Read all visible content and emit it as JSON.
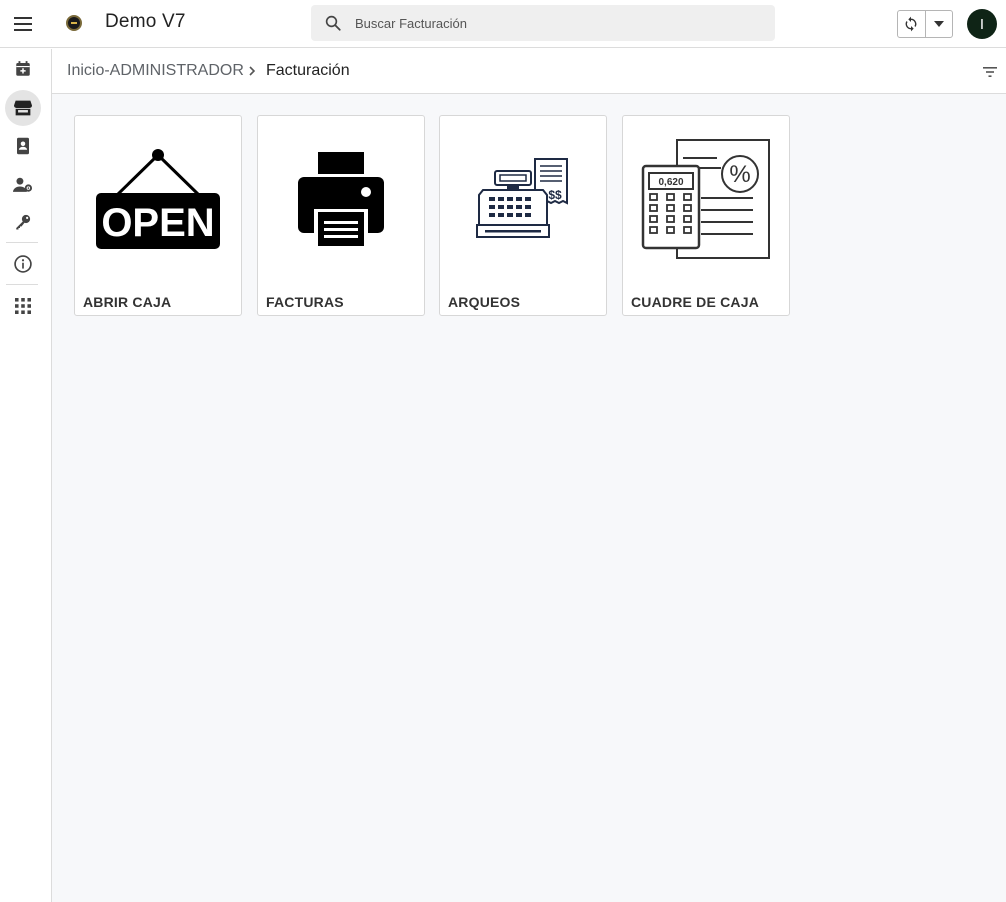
{
  "app": {
    "title": "Demo V7"
  },
  "search": {
    "placeholder": "Buscar Facturación"
  },
  "user": {
    "initial": "I"
  },
  "breadcrumb": {
    "root": "Inicio-ADMINISTRADOR",
    "current": "Facturación"
  },
  "sidebar": {
    "items": [
      {
        "icon": "calendar-add-icon"
      },
      {
        "icon": "store-icon",
        "active": true
      },
      {
        "icon": "contact-book-icon"
      },
      {
        "icon": "user-settings-icon"
      },
      {
        "icon": "key-icon"
      },
      {
        "icon": "info-icon"
      },
      {
        "icon": "apps-grid-icon"
      }
    ]
  },
  "cards": [
    {
      "label": "ABRIR CAJA",
      "icon": "open-sign-icon",
      "sign_text": "OPEN"
    },
    {
      "label": "FACTURAS",
      "icon": "printer-icon"
    },
    {
      "label": "ARQUEOS",
      "icon": "cash-register-icon",
      "receipt_text": "$$"
    },
    {
      "label": "CUADRE DE CAJA",
      "icon": "calculator-report-icon",
      "display_text": "0,620",
      "symbol": "%"
    }
  ],
  "colors": {
    "avatar_bg": "#0f2416",
    "main_bg": "#f7f8fa",
    "active_item_bg": "#e4e4e4"
  }
}
